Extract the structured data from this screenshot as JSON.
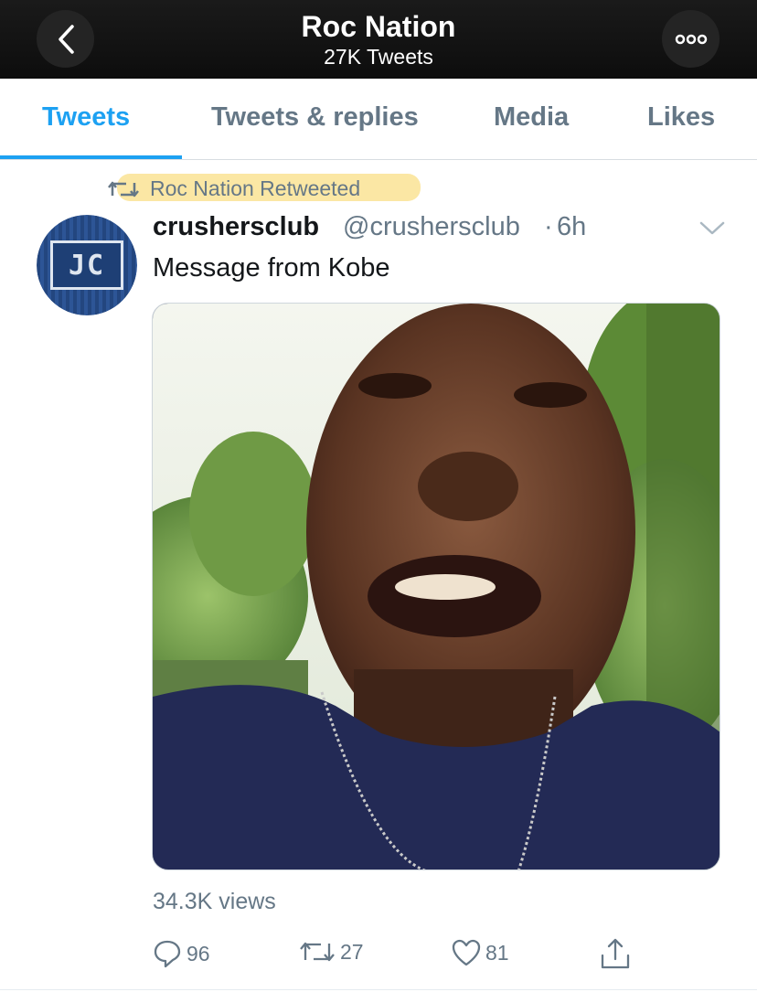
{
  "header": {
    "title": "Roc Nation",
    "subtitle": "27K Tweets"
  },
  "tabs": [
    {
      "label": "Tweets",
      "active": true
    },
    {
      "label": "Tweets & replies",
      "active": false
    },
    {
      "label": "Media",
      "active": false
    },
    {
      "label": "Likes",
      "active": false
    }
  ],
  "retweet": {
    "label": "Roc Nation Retweeted",
    "icon": "retweet-icon"
  },
  "tweet": {
    "avatar_text": "JC",
    "display_name": "crushersclub",
    "handle": "@crushersclub",
    "separator": "·",
    "time": "6h",
    "text": "Message from Kobe",
    "views": "34.3K views",
    "actions": {
      "replies": "96",
      "retweets": "27",
      "likes": "81"
    }
  },
  "colors": {
    "accent": "#1da1f2",
    "secondary_text": "#657786",
    "highlight": "#fbe49a",
    "header_bg": "#111111"
  }
}
